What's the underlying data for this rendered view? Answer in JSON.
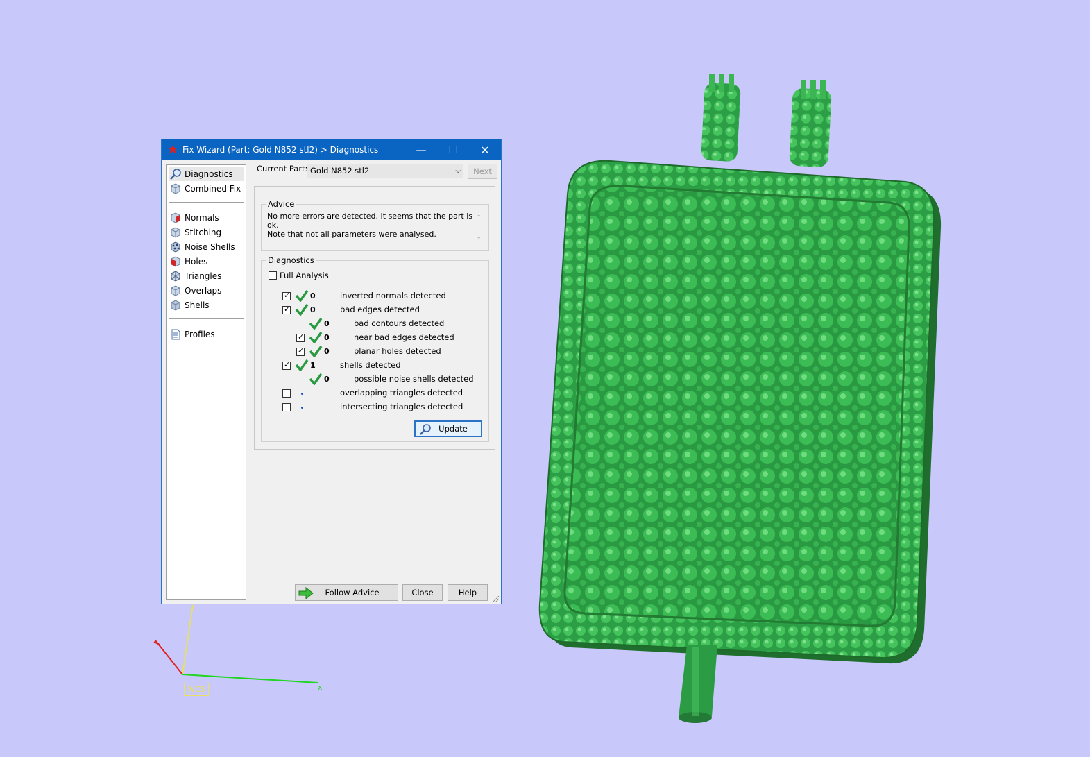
{
  "window": {
    "title": "Fix Wizard (Part: Gold N852 stl2) > Diagnostics",
    "min_glyph": "—",
    "max_glyph": "☐",
    "close_glyph": "✕"
  },
  "nav": {
    "items": [
      {
        "label": "Diagnostics",
        "icon": "magnifier-icon"
      },
      {
        "label": "Combined Fix",
        "icon": "cube-icon"
      },
      {
        "label": "Normals",
        "icon": "normals-cube-icon"
      },
      {
        "label": "Stitching",
        "icon": "stitching-cube-icon"
      },
      {
        "label": "Noise Shells",
        "icon": "noise-shells-icon"
      },
      {
        "label": "Holes",
        "icon": "holes-cube-icon"
      },
      {
        "label": "Triangles",
        "icon": "triangles-cube-icon"
      },
      {
        "label": "Overlaps",
        "icon": "overlaps-cube-icon"
      },
      {
        "label": "Shells",
        "icon": "shells-cube-icon"
      },
      {
        "label": "Profiles",
        "icon": "profiles-document-icon"
      }
    ],
    "selected": "Diagnostics"
  },
  "current_part": {
    "label": "Current Part:",
    "value": "Gold N852 stl2",
    "next_label": "Next"
  },
  "advice": {
    "legend": "Advice",
    "line1": "No more errors are detected. It seems that the part is ok.",
    "line2": "Note that not all parameters were analysed."
  },
  "diagnostics": {
    "legend": "Diagnostics",
    "full_analysis_label": "Full Analysis",
    "rows": [
      {
        "label": "inverted normals detected",
        "count": "0",
        "checked": true
      },
      {
        "label": "bad edges detected",
        "count": "0",
        "checked": true
      },
      {
        "label": "bad contours detected",
        "count": "0"
      },
      {
        "label": "near bad edges detected",
        "count": "0",
        "checked": true
      },
      {
        "label": "planar holes detected",
        "count": "0",
        "checked": true
      },
      {
        "label": "shells detected",
        "count": "1",
        "checked": true
      },
      {
        "label": "possible noise shells detected",
        "count": "0"
      },
      {
        "label": "overlapping triangles detected",
        "checked": false
      },
      {
        "label": "intersecting triangles detected",
        "checked": false
      }
    ],
    "update_label": "Update"
  },
  "footer": {
    "follow_advice_label": "Follow Advice",
    "close_label": "Close",
    "help_label": "Help"
  },
  "viewport": {
    "wcs_label": "WCS",
    "x_axis_label": "x",
    "model_color": "#2fa84a",
    "background_color": "#c8c8fa"
  }
}
